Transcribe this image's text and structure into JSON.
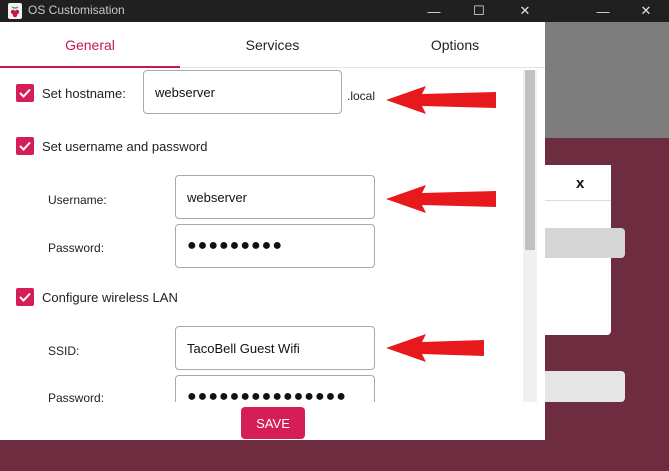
{
  "window": {
    "title": "OS Customisation",
    "controls": {
      "minimize": "—",
      "maximize": "☐",
      "close": "✕"
    }
  },
  "background_dialog": {
    "close_label": "x"
  },
  "tabs": [
    {
      "label": "General",
      "active": true
    },
    {
      "label": "Services",
      "active": false
    },
    {
      "label": "Options",
      "active": false
    }
  ],
  "general": {
    "hostname": {
      "checked": true,
      "label": "Set hostname:",
      "value": "webserver",
      "suffix": ".local"
    },
    "user": {
      "checked": true,
      "label": "Set username and password",
      "username_label": "Username:",
      "username_value": "webserver",
      "password_label": "Password:",
      "password_value": "●●●●●●●●●"
    },
    "wlan": {
      "checked": true,
      "label": "Configure wireless LAN",
      "ssid_label": "SSID:",
      "ssid_value": "TacoBell Guest Wifi",
      "password_label": "Password:",
      "password_value": "●●●●●●●●●●●●●●●"
    }
  },
  "save_label": "SAVE",
  "colors": {
    "accent": "#d51d58",
    "annotation_arrow": "#e8191d",
    "background_maroon": "#6e2c41"
  },
  "icons": {
    "app": "raspberry-pi-icon",
    "checkbox": "check-icon",
    "annotation": "red-arrow-icon"
  }
}
